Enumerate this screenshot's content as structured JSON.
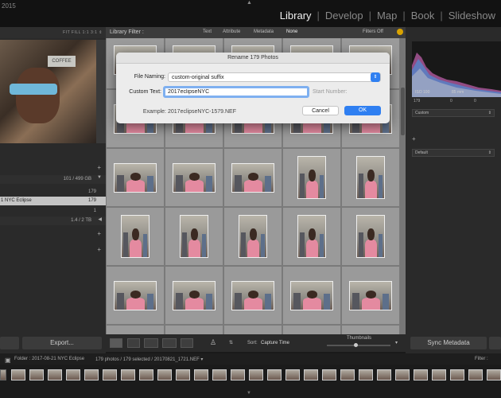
{
  "app": {
    "corner_text": "2015"
  },
  "modules": [
    "Library",
    "Develop",
    "Map",
    "Book",
    "Slideshow"
  ],
  "navigator": {
    "zoom_labels": "FIT  FILL  1:1  3:1 ⇕",
    "sign_text": "COFFEE"
  },
  "left_panel": {
    "rows": [
      {
        "label": "",
        "value": "101 / 499 GB"
      },
      {
        "label": "",
        "value": "179"
      },
      {
        "label": "1 NYC Eclipse",
        "value": "179"
      },
      {
        "label": "",
        "value": "1"
      },
      {
        "label": "",
        "value": "1.4 / 2 TB"
      }
    ],
    "export_label": "Export..."
  },
  "filter_bar": {
    "title": "Library Filter :",
    "options": [
      "Text",
      "Attribute",
      "Metadata",
      "None"
    ],
    "filters_off": "Filters Off"
  },
  "toolbar": {
    "sort_label": "Sort:",
    "sort_value": "Capture Time",
    "thumbnails_label": "Thumbnails"
  },
  "right_panel": {
    "iso": "ISO 100",
    "focal": "85 mm",
    "count": "179",
    "preset_select": "Custom",
    "default_select": "Default",
    "sync_label": "Sync Metadata"
  },
  "filmstrip_bar": {
    "folder": "Folder : 2017-08-21 NYC Eclipse",
    "photos": "179 photos / 179 selected / 20170821_1721.NEF ▾",
    "filter": "Filter :"
  },
  "dialog": {
    "title": "Rename 179 Photos",
    "file_naming_label": "File Naming:",
    "file_naming_value": "custom-original suffix",
    "custom_text_label": "Custom Text:",
    "custom_text_value": "2017eclipseNYC",
    "start_number_label": "Start Number:",
    "example_label": "Example:",
    "example_value": "2017eclipseNYC-1579.NEF",
    "cancel_label": "Cancel",
    "ok_label": "OK"
  },
  "colors": {
    "accent": "#2f7ff1",
    "grid_bg": "#8c8c8c",
    "panel_bg": "#2a2a2a"
  }
}
